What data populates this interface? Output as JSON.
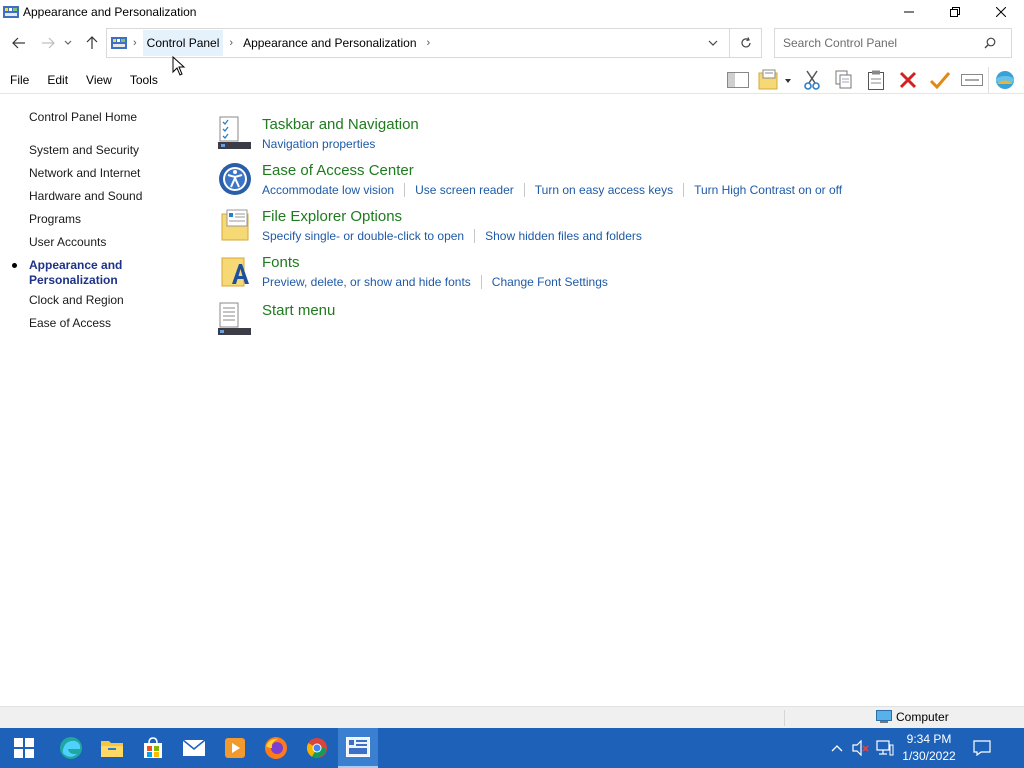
{
  "window": {
    "title": "Appearance and Personalization"
  },
  "address": {
    "crumbs": [
      "Control Panel",
      "Appearance and Personalization"
    ],
    "search_placeholder": "Search Control Panel"
  },
  "menu": {
    "file": "File",
    "edit": "Edit",
    "view": "View",
    "tools": "Tools"
  },
  "leftnav": {
    "home": "Control Panel Home",
    "items": [
      "System and Security",
      "Network and Internet",
      "Hardware and Sound",
      "Programs",
      "User Accounts",
      "Appearance and",
      "Personalization",
      "Clock and Region",
      "Ease of Access"
    ]
  },
  "categories": [
    {
      "title": "Taskbar and Navigation",
      "icon": "taskbar-icon",
      "links": [
        "Navigation properties"
      ]
    },
    {
      "title": "Ease of Access Center",
      "icon": "ease-of-access-icon",
      "links": [
        "Accommodate low vision",
        "Use screen reader",
        "Turn on easy access keys",
        "Turn High Contrast on or off"
      ]
    },
    {
      "title": "File Explorer Options",
      "icon": "folder-options-icon",
      "links": [
        "Specify single- or double-click to open",
        "Show hidden files and folders"
      ]
    },
    {
      "title": "Fonts",
      "icon": "fonts-icon",
      "links": [
        "Preview, delete, or show and hide fonts",
        "Change Font Settings"
      ]
    },
    {
      "title": "Start menu",
      "icon": "start-menu-icon",
      "links": []
    }
  ],
  "statusbar": {
    "location": "Computer"
  },
  "taskbar": {
    "time": "9:34 PM",
    "date": "1/30/2022"
  },
  "colors": {
    "category_title": "#1e7b1e",
    "link": "#1e5aa8",
    "taskbar": "#1d62b8",
    "active_nav": "#1e3287"
  }
}
